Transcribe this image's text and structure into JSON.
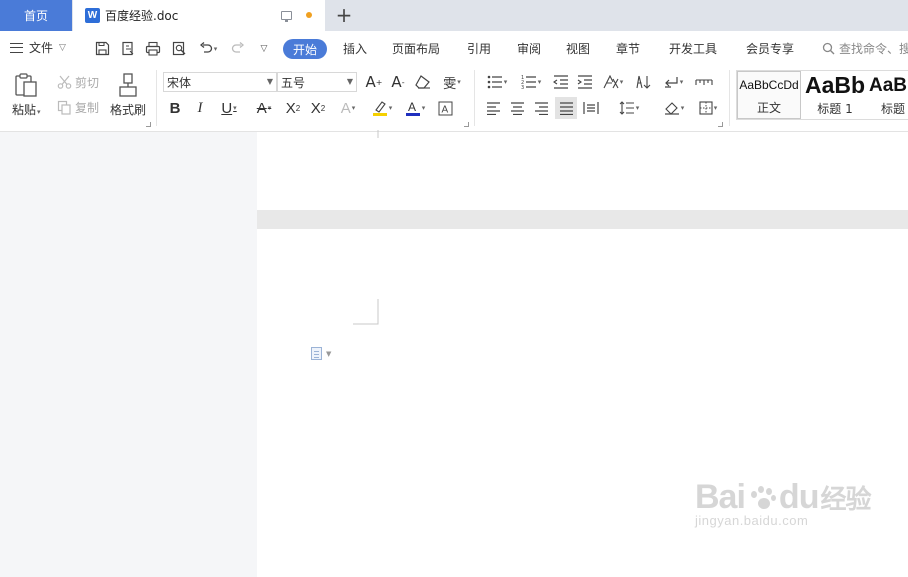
{
  "tabs": {
    "home_label": "首页",
    "doc_title": "百度经验.doc",
    "doc_icon_letter": "W",
    "add_label": "+"
  },
  "menubar": {
    "file_label": "文件",
    "items": [
      "开始",
      "插入",
      "页面布局",
      "引用",
      "审阅",
      "视图",
      "章节",
      "开发工具",
      "会员专享"
    ],
    "search_placeholder": "查找命令、搜"
  },
  "ribbon": {
    "paste_label": "粘贴",
    "cut_label": "剪切",
    "copy_label": "复制",
    "format_painter_label": "格式刷",
    "font_name": "宋体",
    "font_size": "五号",
    "styles": [
      {
        "preview": "AaBbCcDd",
        "label": "正文"
      },
      {
        "preview": "AaBb",
        "label": "标题 1"
      },
      {
        "preview": "AaBl",
        "label": "标题"
      }
    ]
  },
  "colors": {
    "accent": "#4a7bd8",
    "unsaved_dot": "#f0a020",
    "font_color_bar": "#1f2fbf",
    "highlight_bar": "#f5d000"
  },
  "watermark": {
    "brand_left": "Bai",
    "brand_right": "du",
    "brand_cn": "经验",
    "url": "jingyan.baidu.com"
  }
}
